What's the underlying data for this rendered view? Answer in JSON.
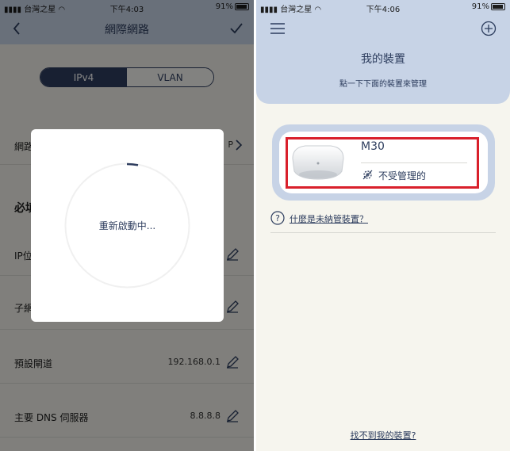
{
  "left": {
    "status": {
      "carrier": "台灣之星",
      "time": "下午4:03",
      "battery": "91%"
    },
    "title": "網際網路",
    "segments": [
      "IPv4",
      "VLAN"
    ],
    "rows": [
      {
        "label": "網路",
        "value": "P"
      },
      {
        "label": "IP位",
        "value": ""
      },
      {
        "label": "子網",
        "value": ""
      },
      {
        "label": "預設閘道",
        "value": "192.168.0.1"
      },
      {
        "label": "主要 DNS 伺服器",
        "value": "8.8.8.8"
      }
    ],
    "section": "必填",
    "dialog": {
      "message": "重新啟動中..."
    }
  },
  "right": {
    "status": {
      "carrier": "台灣之星",
      "time": "下午4:06",
      "battery": "91%"
    },
    "title": "我的裝置",
    "subtitle": "點一下下面的裝置來管理",
    "device": {
      "name": "M30",
      "status": "不受管理的"
    },
    "help_link": "什麼是未納管裝置？",
    "bottom_link": "找不到我的裝置?"
  },
  "colors": {
    "accent": "#2f3e5f",
    "header": "#c7d3e6",
    "highlight": "#d9202b"
  }
}
